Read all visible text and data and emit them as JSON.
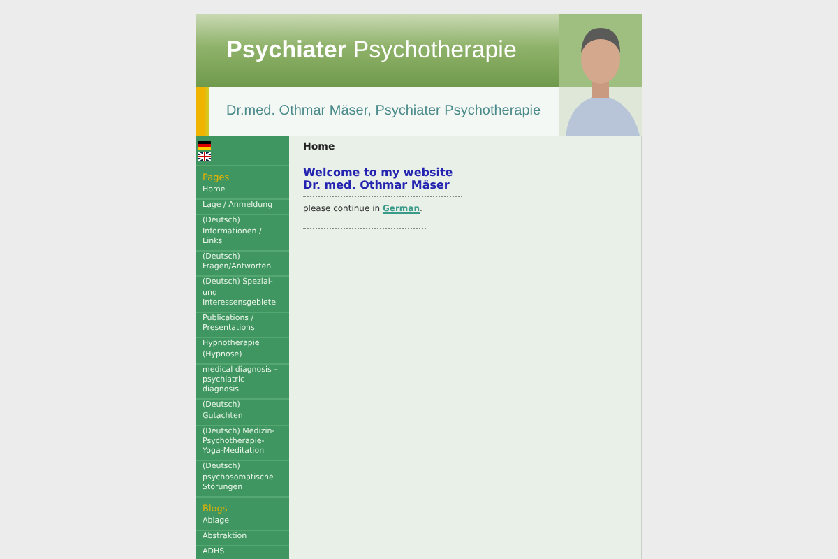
{
  "header": {
    "title_bold": "Psychiater",
    "title_rest": "Psychotherapie",
    "subtitle": "Dr.med. Othmar Mäser, Psychiater Psychotherapie"
  },
  "sidebar": {
    "sections": [
      {
        "heading": "Pages",
        "items": [
          {
            "label": "Home"
          },
          {
            "label": "Lage / Anmeldung"
          },
          {
            "label": "(Deutsch) Informationen / Links"
          },
          {
            "label": "(Deutsch) Fragen/Antworten"
          },
          {
            "label": "(Deutsch) Spezial- und Interessensgebiete"
          },
          {
            "label": "Publications / Presentations"
          },
          {
            "label": "Hypnotherapie (Hypnose)"
          },
          {
            "label": "medical diagnosis – psychiatric diagnosis"
          },
          {
            "label": "(Deutsch) Gutachten"
          },
          {
            "label": "(Deutsch) Medizin-Psychotherapie-Yoga-Meditation"
          },
          {
            "label": "(Deutsch) psychosomatische Störungen"
          }
        ]
      },
      {
        "heading": "Blogs",
        "items": [
          {
            "label": "Ablage"
          },
          {
            "label": "Abstraktion"
          },
          {
            "label": "ADHS"
          }
        ]
      }
    ]
  },
  "content": {
    "breadcrumb": "Home",
    "heading_lines": [
      "Welcome to my website",
      "Dr. med. Othmar Mäser"
    ],
    "text": "please continue in",
    "link": "German",
    "after_link": "."
  }
}
